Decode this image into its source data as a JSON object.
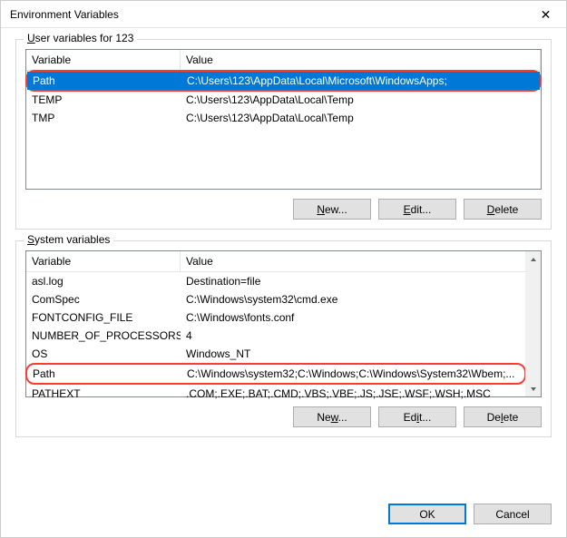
{
  "title": "Environment Variables",
  "user_section": {
    "label_prefix": "U",
    "label_rest": "ser variables for 123",
    "headers": {
      "variable": "Variable",
      "value": "Value"
    },
    "rows": [
      {
        "name": "Path",
        "value": "C:\\Users\\123\\AppData\\Local\\Microsoft\\WindowsApps;",
        "selected": true,
        "highlighted": true
      },
      {
        "name": "TEMP",
        "value": "C:\\Users\\123\\AppData\\Local\\Temp"
      },
      {
        "name": "TMP",
        "value": "C:\\Users\\123\\AppData\\Local\\Temp"
      }
    ],
    "buttons": {
      "new_ul": "N",
      "new_rest": "ew...",
      "edit_ul": "E",
      "edit_rest": "dit...",
      "delete_ul": "D",
      "delete_rest": "elete"
    }
  },
  "system_section": {
    "label_prefix": "S",
    "label_rest": "ystem variables",
    "headers": {
      "variable": "Variable",
      "value": "Value"
    },
    "rows": [
      {
        "name": "asl.log",
        "value": "Destination=file"
      },
      {
        "name": "ComSpec",
        "value": "C:\\Windows\\system32\\cmd.exe"
      },
      {
        "name": "FONTCONFIG_FILE",
        "value": "C:\\Windows\\fonts.conf"
      },
      {
        "name": "NUMBER_OF_PROCESSORS",
        "value": "4"
      },
      {
        "name": "OS",
        "value": "Windows_NT"
      },
      {
        "name": "Path",
        "value": "C:\\Windows\\system32;C:\\Windows;C:\\Windows\\System32\\Wbem;...",
        "highlighted": true
      },
      {
        "name": "PATHEXT",
        "value": ".COM;.EXE;.BAT;.CMD;.VBS;.VBE;.JS;.JSE;.WSF;.WSH;.MSC"
      }
    ],
    "buttons": {
      "new_pre": "Ne",
      "new_ul": "w",
      "new_rest": "...",
      "edit_pre": "Ed",
      "edit_ul": "i",
      "edit_rest": "t...",
      "delete_pre": "De",
      "delete_ul": "l",
      "delete_rest": "ete"
    }
  },
  "footer": {
    "ok": "OK",
    "cancel": "Cancel"
  }
}
